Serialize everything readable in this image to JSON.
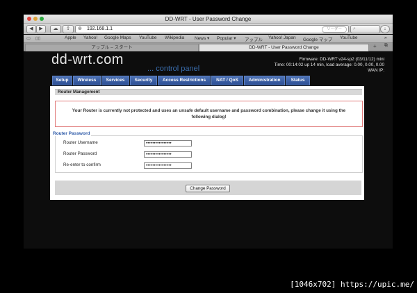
{
  "window": {
    "title": "DD-WRT - User Password Change"
  },
  "toolbar": {
    "cloud_icon": "cloud-icon",
    "share_icon": "share-icon",
    "url": "192.168.1.1",
    "reader": "リーダー"
  },
  "bookmarks": [
    "Apple",
    "Yahoo!",
    "Google Maps",
    "YouTube",
    "Wikipedia",
    "News ▾",
    "Popular ▾",
    "アップル",
    "Yahoo! Japan",
    "Google マップ",
    "YouTube"
  ],
  "tabs": [
    "アップル – スタート",
    "DD-WRT - User Password Change"
  ],
  "header": {
    "logo": "dd-wrt.com",
    "subtitle": "... control panel",
    "firmware": "Firmware: DD-WRT v24-sp2 (03/11/12) mini",
    "time": "Time: 00:14:02 up 14 min, load average: 0.00, 0.00, 0.00",
    "wan": "WAN IP:"
  },
  "nav": [
    "Setup",
    "Wireless",
    "Services",
    "Security",
    "Access Restrictions",
    "NAT / QoS",
    "Administration",
    "Status"
  ],
  "section": {
    "title": "Router Management"
  },
  "warning": "Your Router is currently not protected and uses an unsafe default username and password combination, please change it using the following dialog!",
  "form": {
    "legend": "Router Password",
    "username_label": "Router Username",
    "username_value": "••••••••••••••••",
    "password_label": "Router Password",
    "password_value": "••••••••••••••••",
    "confirm_label": "Re-enter to confirm",
    "confirm_value": "••••••••••••••••"
  },
  "button": {
    "change": "Change Password"
  },
  "watermark": "[1046x702] https://upic.me/"
}
